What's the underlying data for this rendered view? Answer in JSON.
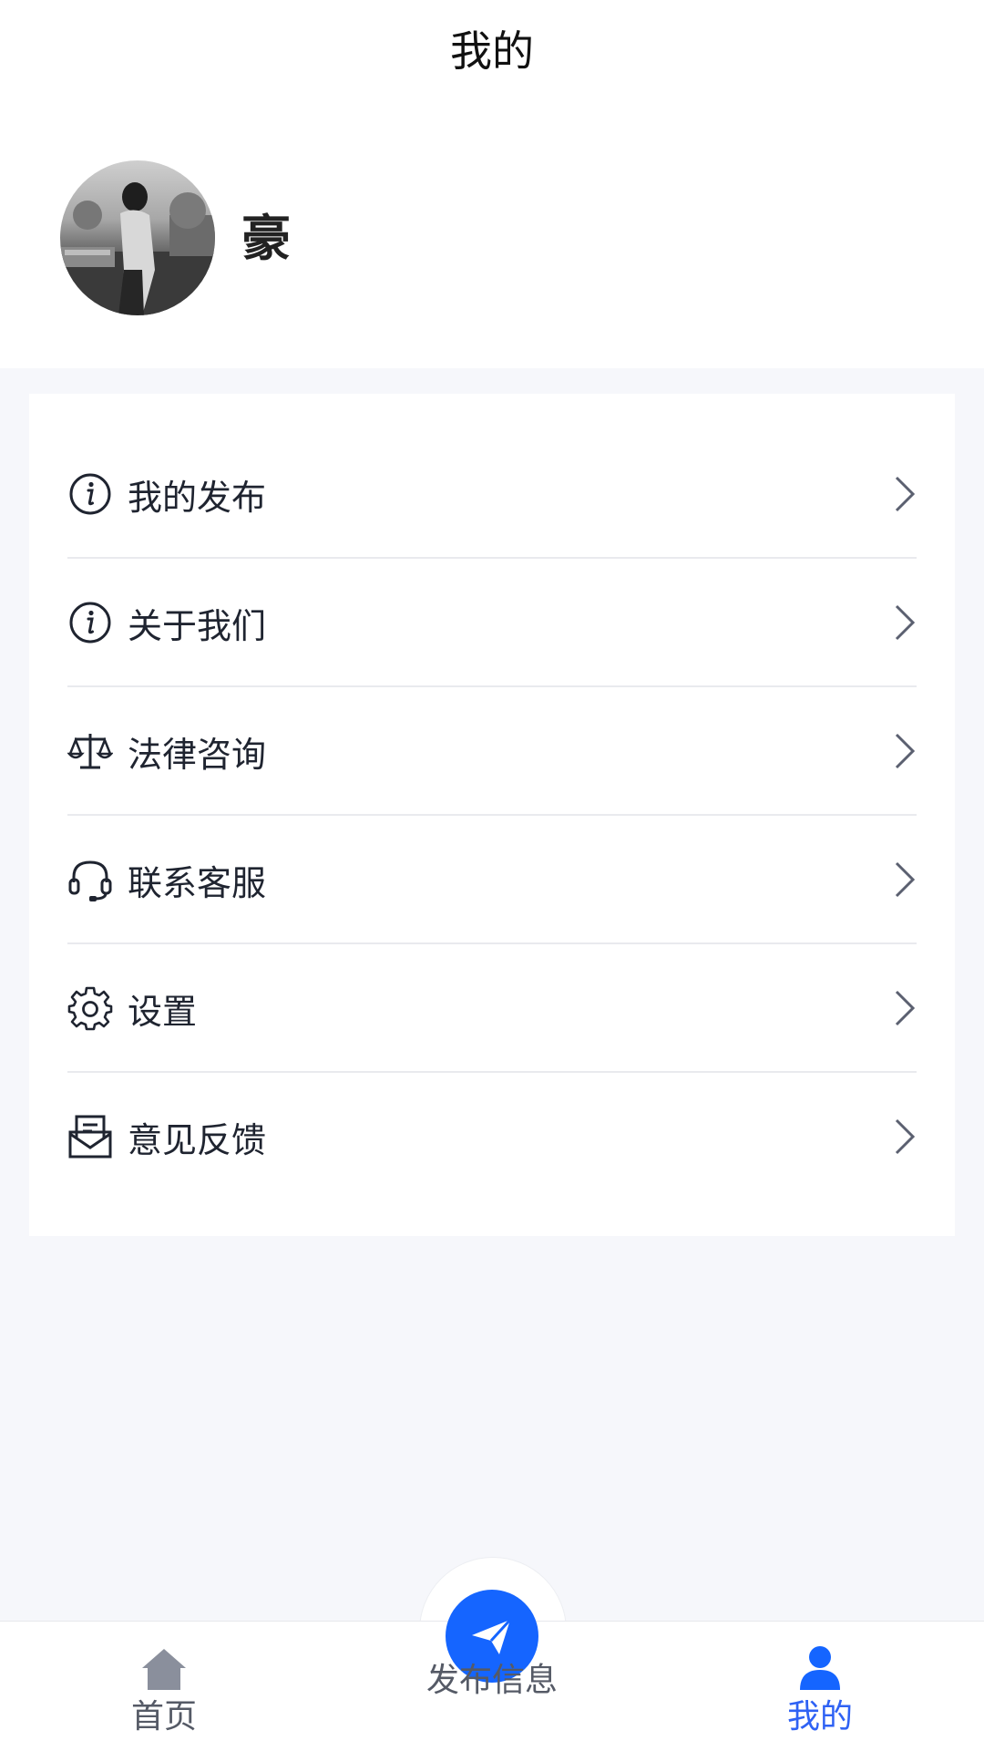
{
  "header": {
    "title": "我的"
  },
  "profile": {
    "name": "豪"
  },
  "menu": {
    "items": [
      {
        "label": "我的发布",
        "icon": "info-icon"
      },
      {
        "label": "关于我们",
        "icon": "info-icon"
      },
      {
        "label": "法律咨询",
        "icon": "scales-icon"
      },
      {
        "label": "联系客服",
        "icon": "headset-icon"
      },
      {
        "label": "设置",
        "icon": "gear-icon"
      },
      {
        "label": "意见反馈",
        "icon": "mail-feedback-icon"
      }
    ]
  },
  "tabbar": {
    "home": {
      "label": "首页",
      "icon": "home-icon"
    },
    "publish": {
      "label": "发布信息",
      "icon": "paper-plane-icon"
    },
    "mine": {
      "label": "我的",
      "icon": "user-icon",
      "active": true
    }
  },
  "colors": {
    "accent": "#1565ff",
    "active_tab": "#2f62f4",
    "background": "#f6f7fb"
  }
}
